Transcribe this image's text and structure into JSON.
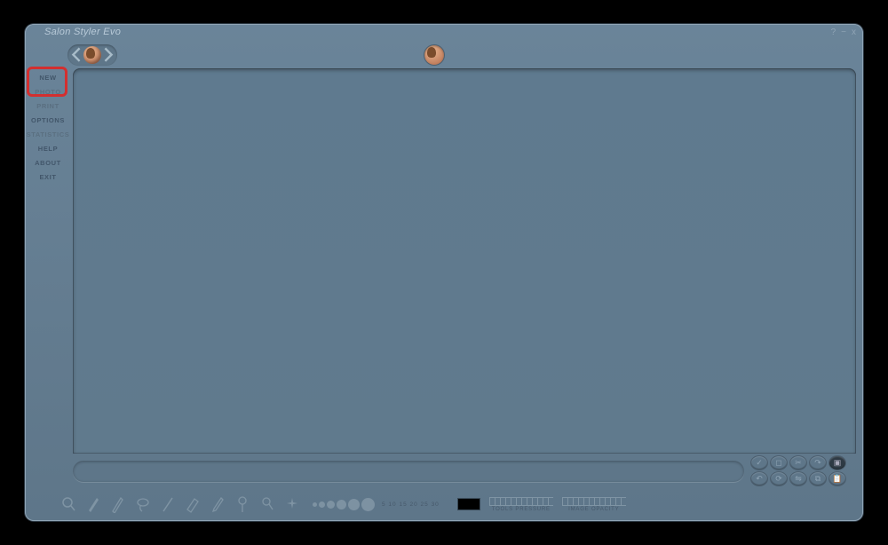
{
  "app": {
    "title": "Salon Styler Evo"
  },
  "window_controls": {
    "help": "?",
    "min": "−",
    "close": "x"
  },
  "sidemenu": {
    "items": [
      {
        "label": "NEW",
        "key": "new",
        "muted": false
      },
      {
        "label": "PHOTO",
        "key": "photo",
        "muted": true
      },
      {
        "label": "PRINT",
        "key": "print",
        "muted": true
      },
      {
        "label": "OPTIONS",
        "key": "options",
        "muted": false
      },
      {
        "label": "STATISTICS",
        "key": "statistics",
        "muted": true
      },
      {
        "label": "HELP",
        "key": "help",
        "muted": false
      },
      {
        "label": "ABOUT",
        "key": "about",
        "muted": false
      },
      {
        "label": "EXIT",
        "key": "exit",
        "muted": false
      }
    ]
  },
  "toolbar": {
    "size_scale": "5  10 15  20  25  30",
    "pressure_label": "TOOLS PRESSURE",
    "opacity_label": "IMAGE OPACITY"
  },
  "action_buttons": {
    "row1": [
      "check-icon",
      "crop-icon",
      "cut-icon",
      "redo-icon",
      "layers-icon"
    ],
    "row2": [
      "undo-icon",
      "rotate-icon",
      "flip-icon",
      "copy-icon",
      "paste-icon"
    ]
  },
  "tools": [
    "zoom-icon",
    "brush-icon",
    "pencil-icon",
    "lasso-icon",
    "line-icon",
    "eraser-icon",
    "eyedropper-icon",
    "gradient-icon",
    "zoom2-icon",
    "sparkle-icon"
  ]
}
